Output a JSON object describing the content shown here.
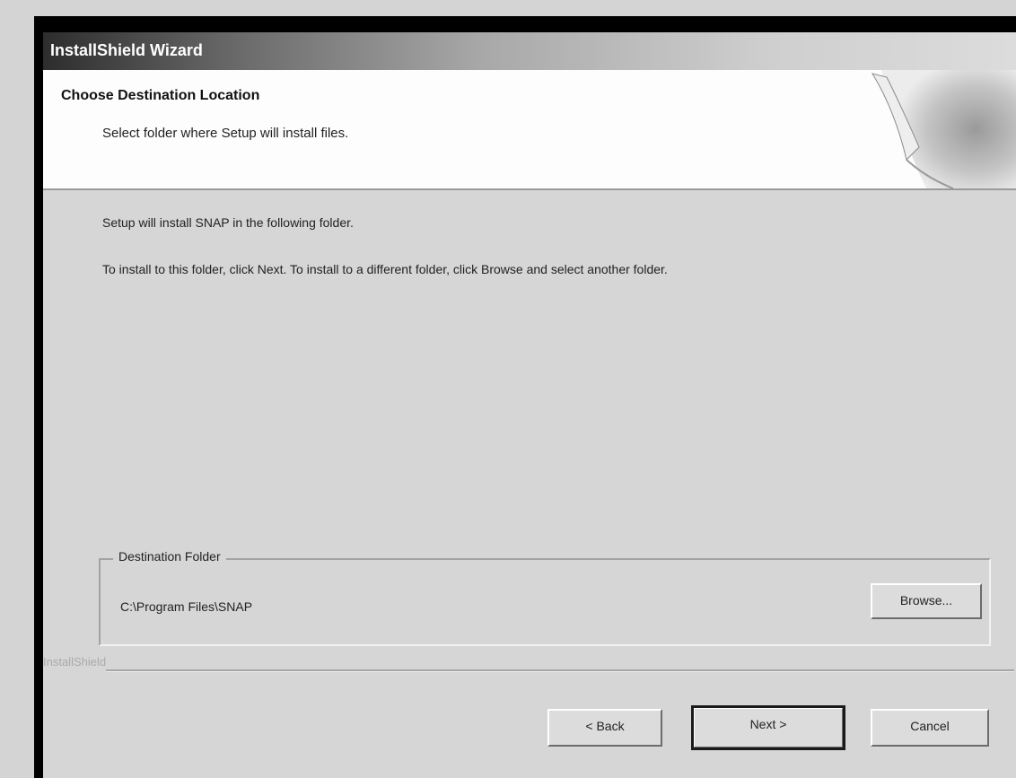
{
  "window": {
    "title": "InstallShield Wizard"
  },
  "header": {
    "title": "Choose Destination Location",
    "subtitle": "Select folder where Setup will install files."
  },
  "body": {
    "line1": "Setup will install SNAP in the following folder.",
    "line2": "To install to this folder, click Next. To install to a different folder, click Browse and select another folder."
  },
  "destination": {
    "group_label": "Destination Folder",
    "path": "C:\\Program Files\\SNAP"
  },
  "buttons": {
    "browse": "Browse...",
    "back": "< Back",
    "next": "Next >",
    "cancel": "Cancel"
  },
  "footer": {
    "brand": "InstallShield"
  }
}
